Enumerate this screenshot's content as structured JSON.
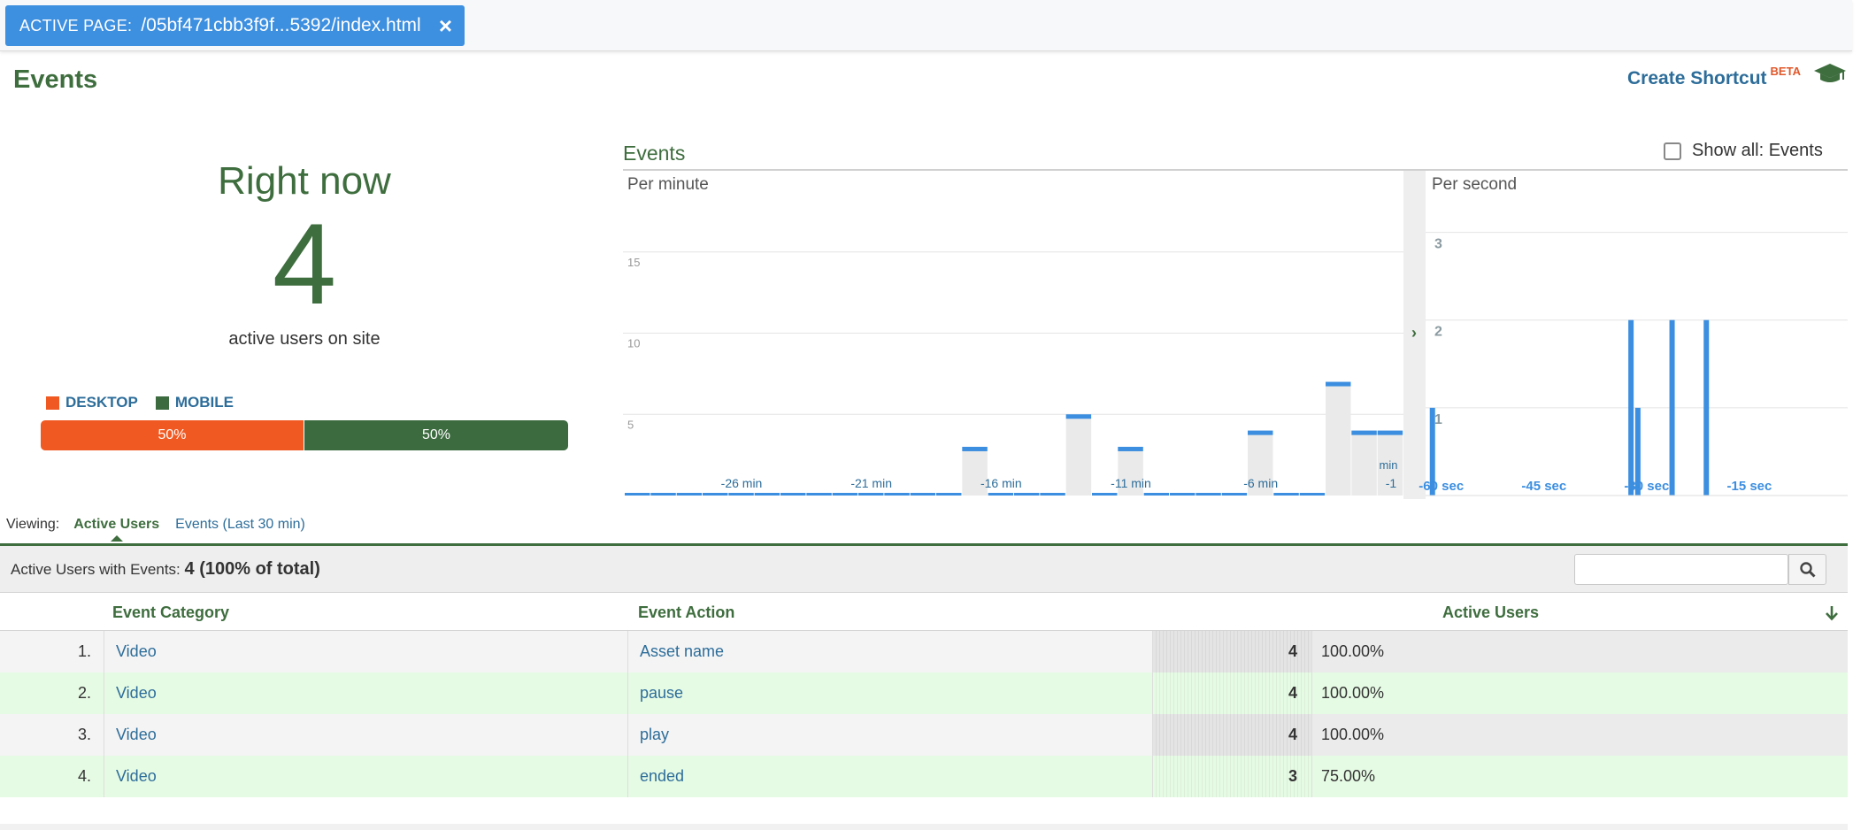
{
  "top_bar": {
    "active_page_label": "ACTIVE PAGE:",
    "active_page_path": "/05bf471cbb3f9f...5392/index.html",
    "close_icon": "×"
  },
  "header": {
    "title": "Events",
    "shortcut_label": "Create Shortcut",
    "shortcut_badge": "BETA",
    "help_icon": "graduation-cap-icon"
  },
  "right_now": {
    "title": "Right now",
    "count": "4",
    "subtitle": "active users on site",
    "legend": [
      {
        "label": "DESKTOP",
        "color": "#f05a22"
      },
      {
        "label": "MOBILE",
        "color": "#3c6b3f"
      }
    ],
    "split": [
      {
        "label": "50%",
        "value": 50
      },
      {
        "label": "50%",
        "value": 50
      }
    ]
  },
  "events_chart": {
    "title": "Events",
    "show_all_label": "Show all: Events"
  },
  "chart_data": [
    {
      "type": "bar",
      "title": "Per minute",
      "y_ticks": [
        "5",
        "10",
        "15"
      ],
      "ylim": [
        0,
        20
      ],
      "x_tick_labels": [
        "-26 min",
        "-21 min",
        "-16 min",
        "-11 min",
        "-6 min",
        "-1",
        "min"
      ],
      "x": [
        -30,
        -29,
        -28,
        -27,
        -26,
        -25,
        -24,
        -23,
        -22,
        -21,
        -20,
        -19,
        -18,
        -17,
        -16,
        -15,
        -14,
        -13,
        -12,
        -11,
        -10,
        -9,
        -8,
        -7,
        -6,
        -5,
        -4,
        -3,
        -2,
        -1
      ],
      "values": [
        0,
        0,
        0,
        0,
        0,
        0,
        0,
        0,
        0,
        0,
        0,
        0,
        0,
        3,
        0,
        0,
        0,
        5,
        0,
        3,
        0,
        0,
        0,
        0,
        4,
        0,
        0,
        7,
        4,
        4
      ]
    },
    {
      "type": "bar",
      "title": "Per second",
      "y_ticks": [
        "1",
        "2",
        "3"
      ],
      "ylim": [
        0,
        3.5
      ],
      "x_tick_labels": [
        "-60 sec",
        "-45 sec",
        "-30 sec",
        "-15 sec"
      ],
      "bars": [
        {
          "x": -60,
          "value": 1
        },
        {
          "x": -31,
          "value": 2
        },
        {
          "x": -30,
          "value": 1
        },
        {
          "x": -25,
          "value": 2
        },
        {
          "x": -20,
          "value": 2
        }
      ]
    }
  ],
  "viewing": {
    "label": "Viewing:",
    "tab_active": "Active Users",
    "tab_other": "Events (Last 30 min)"
  },
  "summary": {
    "label": "Active Users with Events:",
    "value": "4 (100% of total)"
  },
  "table": {
    "headers": {
      "category": "Event Category",
      "action": "Event Action",
      "users": "Active Users"
    },
    "sort_icon": "arrow-down-icon",
    "rows": [
      {
        "num": "1.",
        "category": "Video",
        "action": "Asset name",
        "users": "4",
        "pct": "100.00%"
      },
      {
        "num": "2.",
        "category": "Video",
        "action": "pause",
        "users": "4",
        "pct": "100.00%"
      },
      {
        "num": "3.",
        "category": "Video",
        "action": "play",
        "users": "4",
        "pct": "100.00%"
      },
      {
        "num": "4.",
        "category": "Video",
        "action": "ended",
        "users": "3",
        "pct": "75.00%"
      }
    ]
  }
}
